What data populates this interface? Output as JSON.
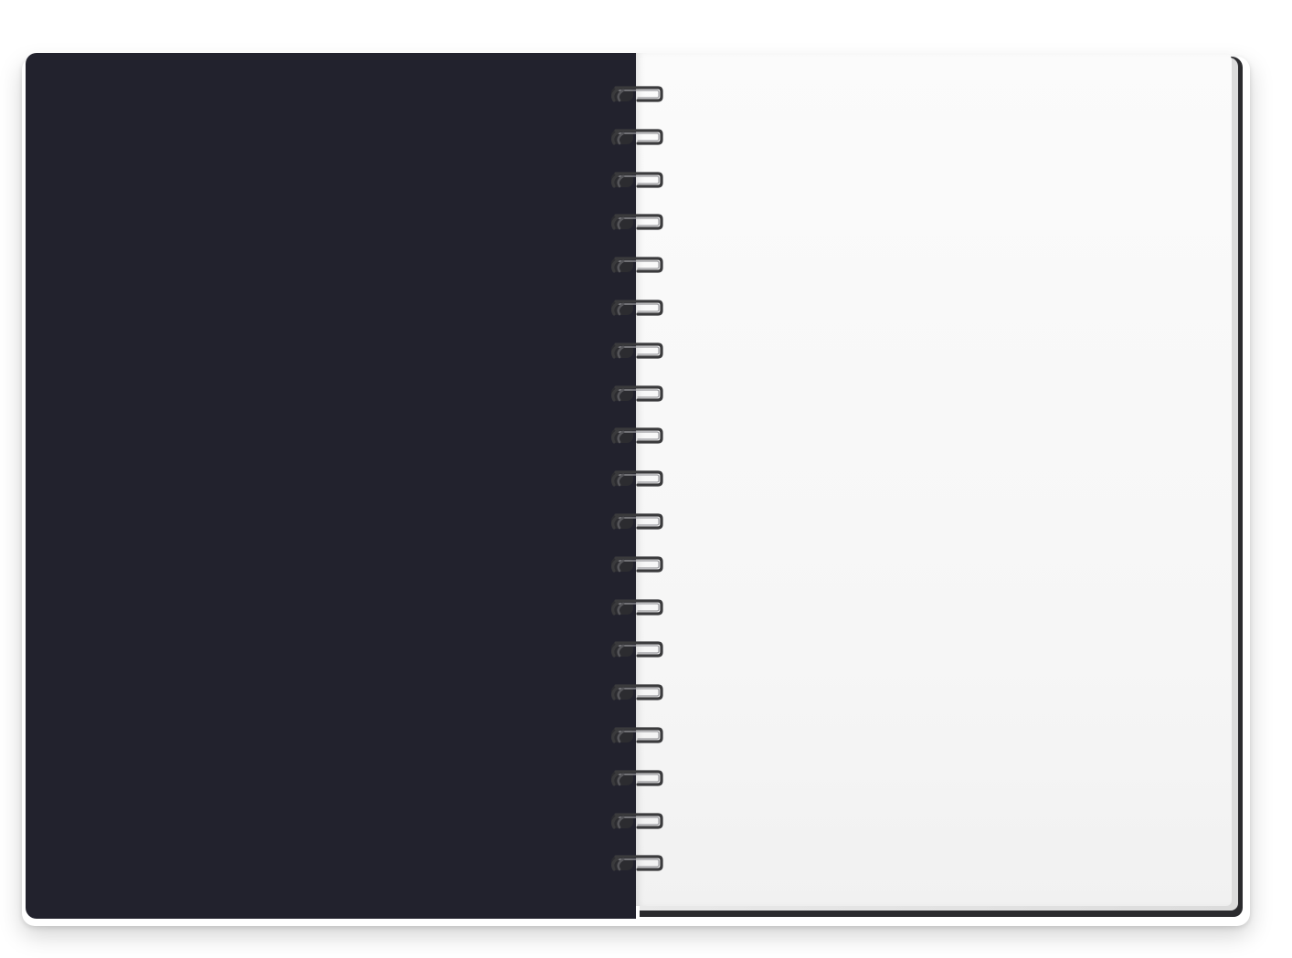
{
  "scene": {
    "colors": {
      "cover": "#22222d",
      "page": "#f7f7f7",
      "back_cover_edge": "#2b2b2e",
      "wire": "#3a3a3c",
      "background": "#ffffff"
    },
    "coil_count": 19
  }
}
